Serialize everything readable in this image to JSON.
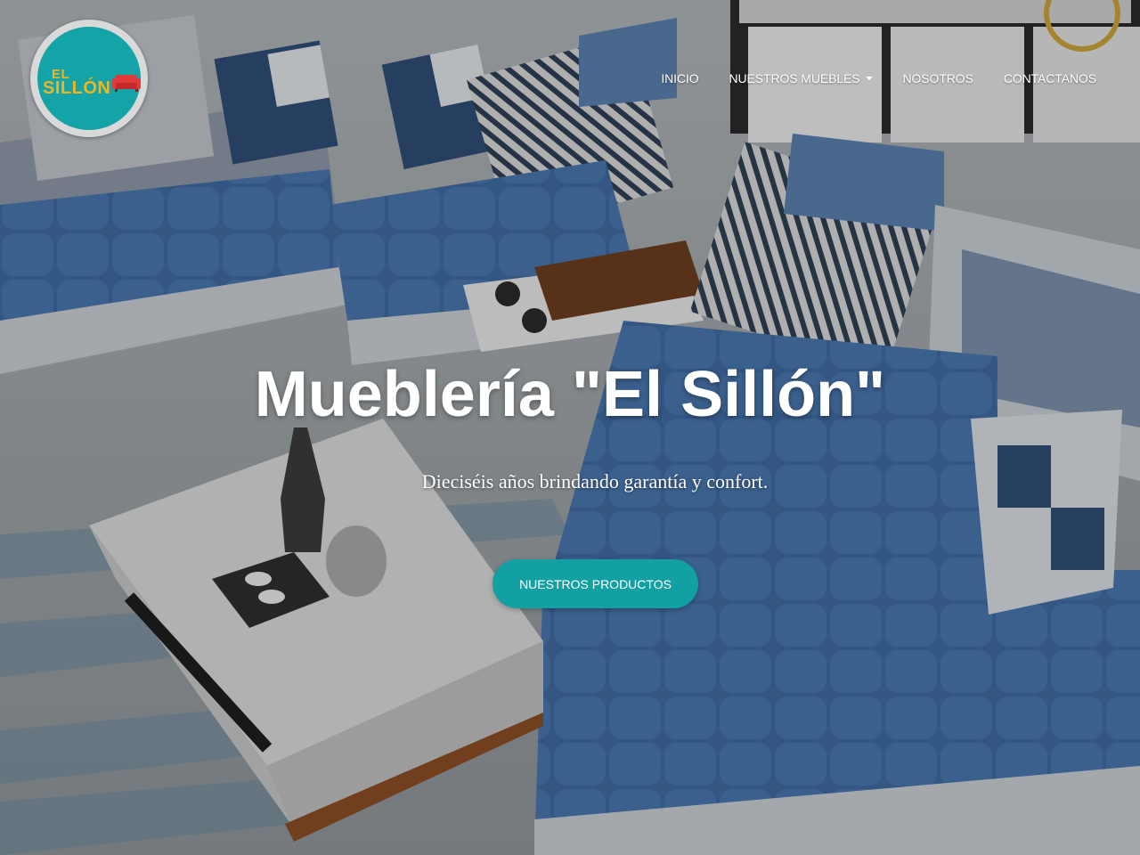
{
  "brand": {
    "logo_line1": "EL",
    "logo_line2": "SILLÓN",
    "colors": {
      "teal": "#13a0a3",
      "gold": "#f2b51f",
      "sofa_red": "#e03a3a"
    }
  },
  "nav": {
    "items": [
      {
        "label": "INICIO",
        "dropdown": false
      },
      {
        "label": "NUESTROS MUEBLES",
        "dropdown": true
      },
      {
        "label": "NOSOTROS",
        "dropdown": false
      },
      {
        "label": "CONTACTANOS",
        "dropdown": false
      }
    ]
  },
  "hero": {
    "title": "Mueblería \"El Sillón\"",
    "subtitle": "Dieciséis años brindando garantía y confort.",
    "cta_label": "NUESTROS PRODUCTOS"
  }
}
